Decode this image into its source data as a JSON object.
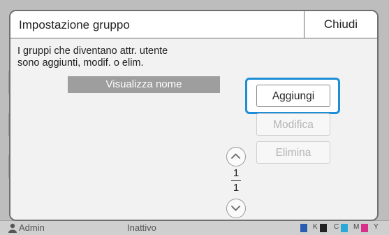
{
  "dialog": {
    "title": "Impostazione gruppo",
    "close_label": "Chiudi",
    "description": "I gruppi che diventano attr. utente\nsono aggiunti, modif. o elim.",
    "column_header": "Visualizza nome",
    "buttons": {
      "add": "Aggiungi",
      "edit": "Modifica",
      "delete": "Elimina"
    },
    "pager": {
      "current": "1",
      "total": "1"
    }
  },
  "background": {
    "user": "Admin",
    "status": "Inattivo",
    "toner_labels": [
      "K",
      "C",
      "M",
      "Y"
    ]
  },
  "colors": {
    "focus": "#1e8fd6",
    "header_band": "#9e9e9e"
  }
}
